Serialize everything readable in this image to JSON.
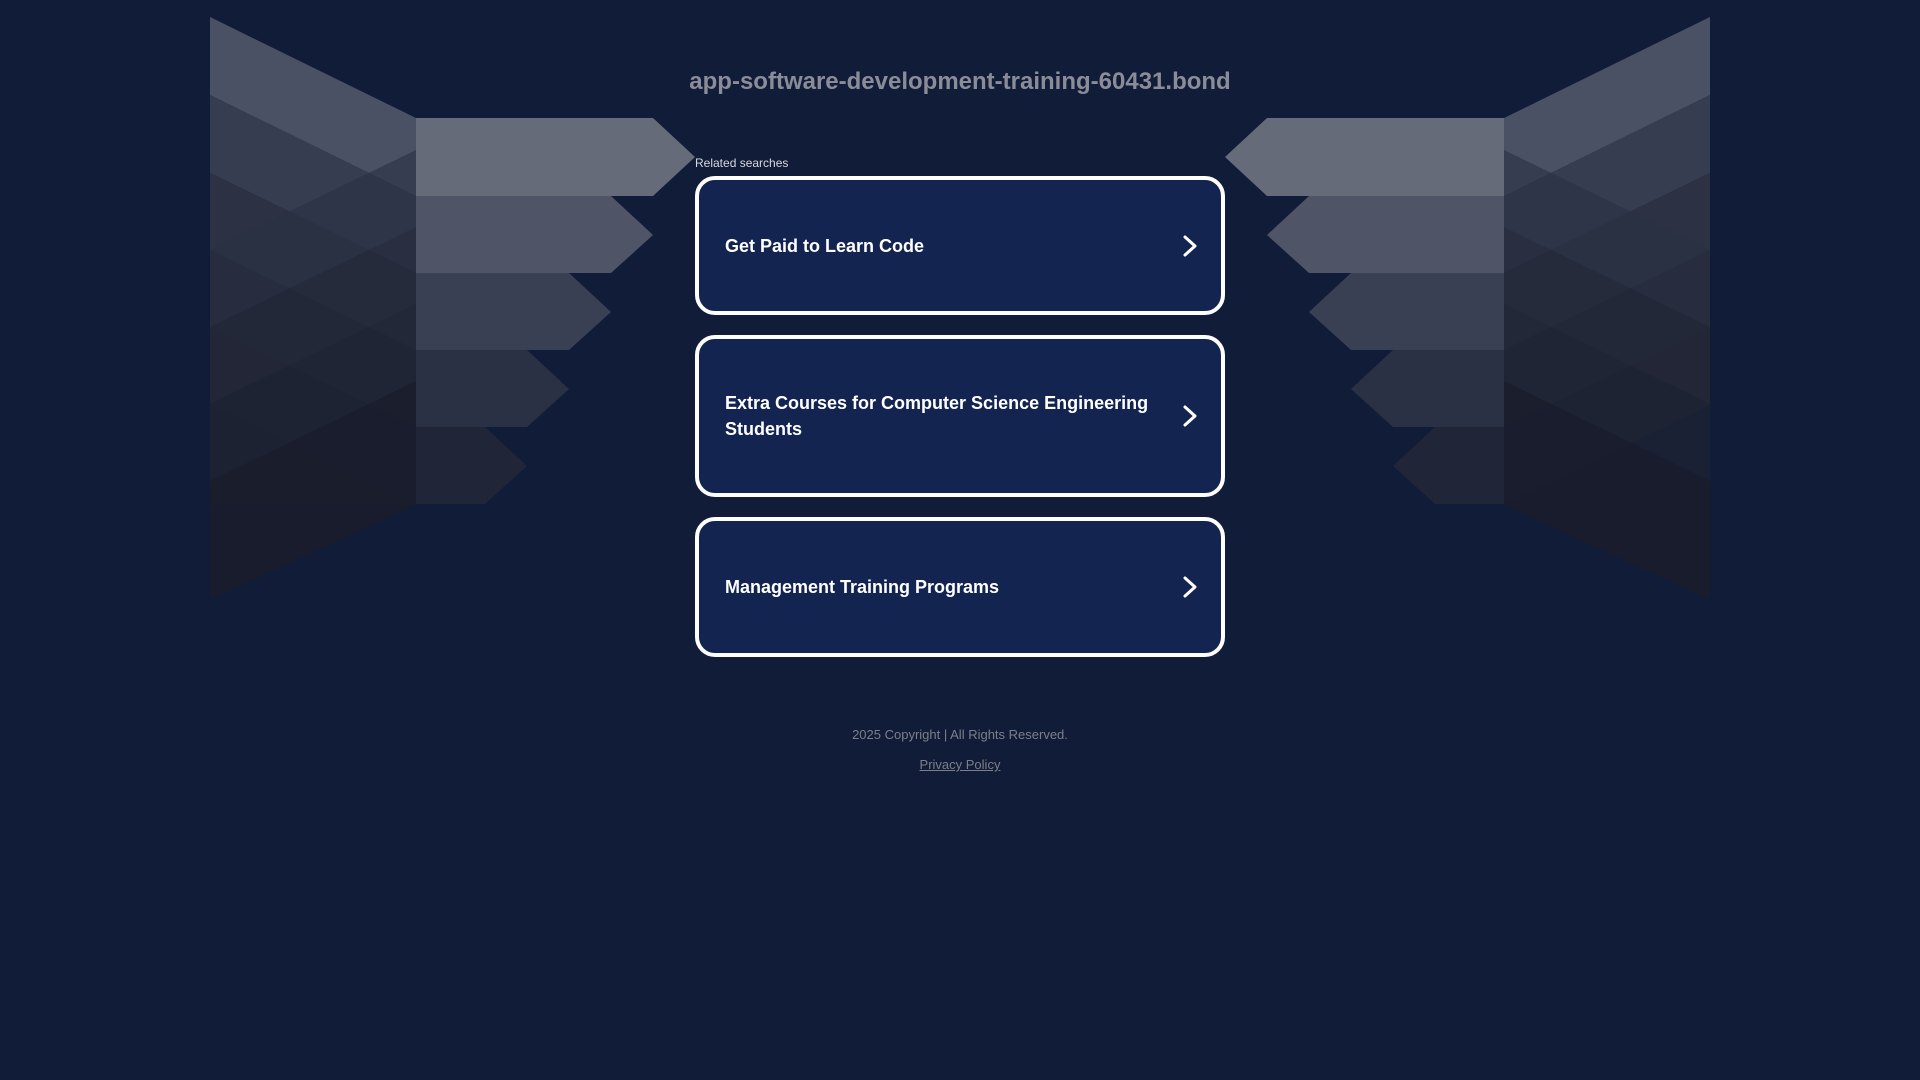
{
  "page": {
    "domain_title": "app-software-development-training-60431.bond",
    "related_label": "Related searches"
  },
  "links": [
    {
      "label": "Get Paid to Learn Code",
      "icon": "chevron-right-icon"
    },
    {
      "label": "Extra Courses for Computer Science Engineering Students",
      "icon": "chevron-right-icon"
    },
    {
      "label": "Management Training Programs",
      "icon": "chevron-right-icon"
    }
  ],
  "footer": {
    "copyright": "2025 Copyright | All Rights Reserved.",
    "privacy_label": "Privacy Policy"
  },
  "colors": {
    "background": "#111c38",
    "card_background": "#12244f",
    "card_border": "#ffffff",
    "title_text": "#8a8d98",
    "footer_text": "#7c7f8a"
  }
}
